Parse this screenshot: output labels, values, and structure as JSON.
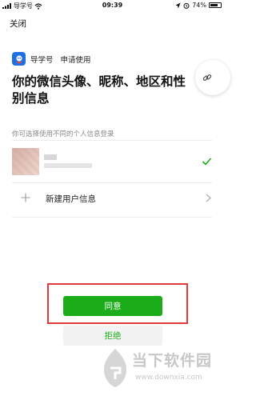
{
  "status_bar": {
    "carrier": "导学号",
    "time": "09:39",
    "battery_percent": "74%",
    "battery_level": 0.74,
    "icons": [
      "signal-icon",
      "wifi-icon",
      "location-icon",
      "alarm-icon",
      "battery-icon"
    ]
  },
  "header": {
    "close_label": "关闭"
  },
  "app": {
    "name": "导学号",
    "request": "申请使用",
    "icon": "app-logo-icon",
    "accent": "#1e6fe0"
  },
  "page": {
    "title": "你的微信头像、昵称、地区和性别信息",
    "subtitle": "你可选择使用不同的个人信息登录"
  },
  "accounts": {
    "selected_icon": "check-icon",
    "new_user_label": "新建用户信息",
    "new_user_icon": "plus-icon",
    "chevron_icon": "chevron-right-icon"
  },
  "actions": {
    "agree_label": "同意",
    "reject_label": "拒绝",
    "primary_color": "#1aad19",
    "highlight_color": "#e03a3a"
  },
  "watermark": {
    "brand": "当下软件园",
    "url": "www.downxia.com"
  }
}
